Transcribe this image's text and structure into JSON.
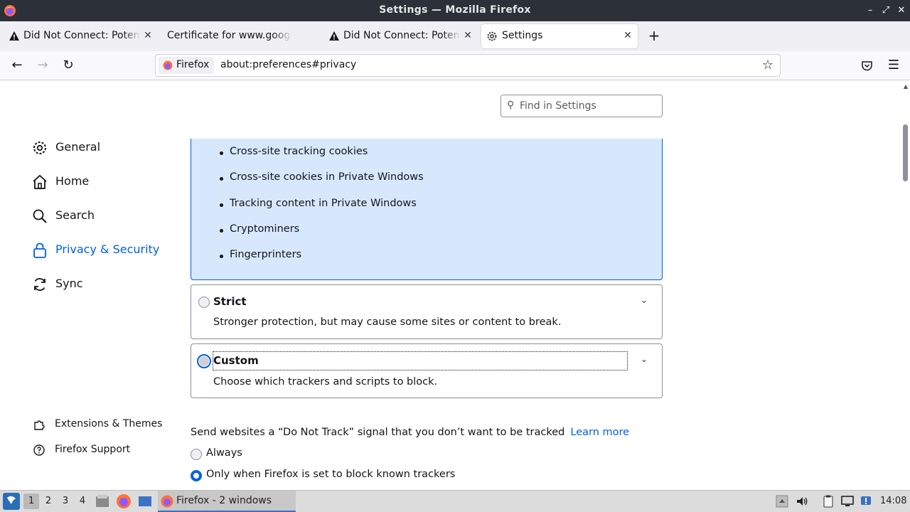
{
  "window": {
    "title": "Settings — Mozilla Firefox",
    "controls": [
      "minimize",
      "maximize",
      "close"
    ]
  },
  "tabs": [
    {
      "label": "Did Not Connect: Potential Security Issue",
      "icon": "warning-icon",
      "active": false
    },
    {
      "label": "Certificate for www.google.com",
      "icon": "none",
      "active": false
    },
    {
      "label": "Did Not Connect: Potential Security Issue",
      "icon": "warning-icon",
      "active": false
    },
    {
      "label": "Settings",
      "icon": "gear-icon",
      "active": true
    }
  ],
  "navbar": {
    "identity_label": "Firefox",
    "url": "about:preferences#privacy"
  },
  "search": {
    "placeholder": "Find in Settings"
  },
  "sidebar": {
    "categories": [
      {
        "label": "General",
        "icon": "gear-icon"
      },
      {
        "label": "Home",
        "icon": "home-icon"
      },
      {
        "label": "Search",
        "icon": "search-icon"
      },
      {
        "label": "Privacy & Security",
        "icon": "lock-icon",
        "selected": true
      },
      {
        "label": "Sync",
        "icon": "sync-icon"
      }
    ],
    "footer": [
      {
        "label": "Extensions & Themes",
        "icon": "puzzle-icon"
      },
      {
        "label": "Firefox Support",
        "icon": "help-icon"
      }
    ]
  },
  "tracking": {
    "standard_items": [
      "Cross-site tracking cookies",
      "Cross-site cookies in Private Windows",
      "Tracking content in Private Windows",
      "Cryptominers",
      "Fingerprinters"
    ],
    "strict": {
      "title": "Strict",
      "description": "Stronger protection, but may cause some sites or content to break."
    },
    "custom": {
      "title": "Custom",
      "description": "Choose which trackers and scripts to block."
    }
  },
  "dnt": {
    "text": "Send websites a “Do Not Track” signal that you don’t want to be tracked",
    "learn_more": "Learn more",
    "options": [
      {
        "label": "Always",
        "selected": false
      },
      {
        "label": "Only when Firefox is set to block known trackers",
        "selected": true
      }
    ]
  },
  "taskbar": {
    "workspaces": [
      "1",
      "2",
      "3",
      "4"
    ],
    "active_workspace": "1",
    "window_label": "Firefox - 2 windows",
    "clock": "14:08"
  },
  "colors": {
    "accent": "#0061e0",
    "selected_box": "#d7e8fc",
    "titlebar": "#2b3039"
  }
}
